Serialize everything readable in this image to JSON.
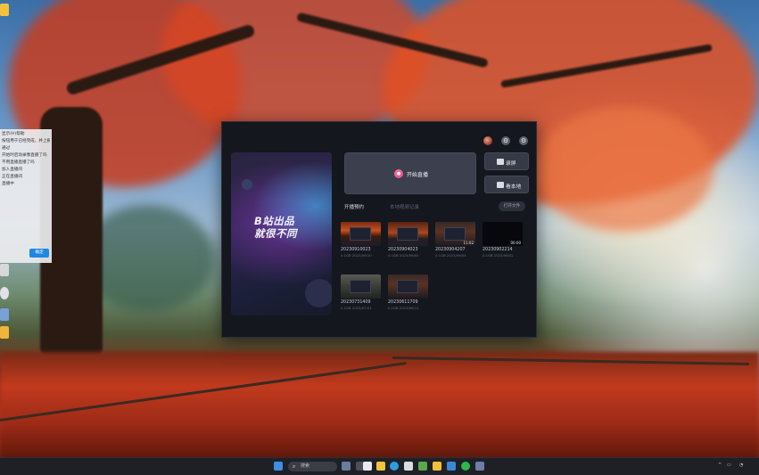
{
  "app": {
    "banner_line1": "B站出品",
    "banner_line2": "就很不同",
    "start_live_label": "开始直播",
    "record_button_label": "录屏",
    "vod_button_label": "看本地",
    "tabs": [
      "开播预约",
      "本地视频记录"
    ],
    "open_folder_label": "打开文件",
    "recordings": [
      {
        "name": "20230910023",
        "sub": "0.1GB 2023/09/10",
        "duration": "",
        "thumb": "th-fire"
      },
      {
        "name": "20230904023",
        "sub": "0.1GB 2023/09/04",
        "duration": "",
        "thumb": "th-fire2"
      },
      {
        "name": "20230904207",
        "sub": "0.1GB 2023/09/04",
        "duration": "11:02",
        "thumb": "th-room2"
      },
      {
        "name": "20230902214",
        "sub": "0.1GB 2023/09/02",
        "duration": "00:00",
        "thumb": "th-dark"
      },
      {
        "name": "20230731409",
        "sub": "0.1GB 2023/07/31",
        "duration": "",
        "thumb": "th-room"
      },
      {
        "name": "20230611709",
        "sub": "0.1GB 2023/06/11",
        "duration": "",
        "thumb": "th-room2"
      }
    ]
  },
  "background_window": {
    "rows": [
      "显示(H)帮助",
      "按钮用于已经完成，并上报",
      "通过",
      "开始时启动录像直播了吗",
      "",
      "不用直播直播了吗",
      "",
      "加入直播间",
      "",
      "",
      "",
      "正在直播间",
      "",
      "直播中"
    ],
    "button_label": "确定"
  },
  "taskbar": {
    "search_placeholder": "搜索",
    "tray_time": ""
  }
}
